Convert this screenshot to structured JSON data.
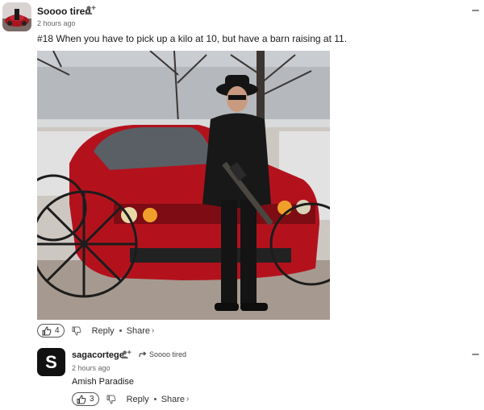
{
  "post": {
    "username": "Soooo tired",
    "time": "2 hours ago",
    "text": "#18 When you have to pick up a kilo at 10, but have a barn raising at 11.",
    "likes": "4",
    "reply_label": "Reply",
    "share_label": "Share"
  },
  "comment": {
    "avatar_letter": "S",
    "username": "sagacortege",
    "reply_to": "Soooo tired",
    "time": "2 hours ago",
    "text": "Amish Paradise",
    "likes": "3",
    "reply_label": "Reply",
    "share_label": "Share"
  },
  "icons": {
    "follow": "follow-user-icon",
    "collapse": "collapse-icon",
    "thumbs_up": "thumbs-up-icon",
    "thumbs_down": "thumbs-down-icon",
    "reply_arrow": "reply-arrow-icon",
    "share_chevron": "chevron-right-icon"
  },
  "colors": {
    "text": "#1a1a1a",
    "muted": "#666666",
    "avatar_comment_bg": "#111111",
    "car_red": "#b3121d"
  }
}
